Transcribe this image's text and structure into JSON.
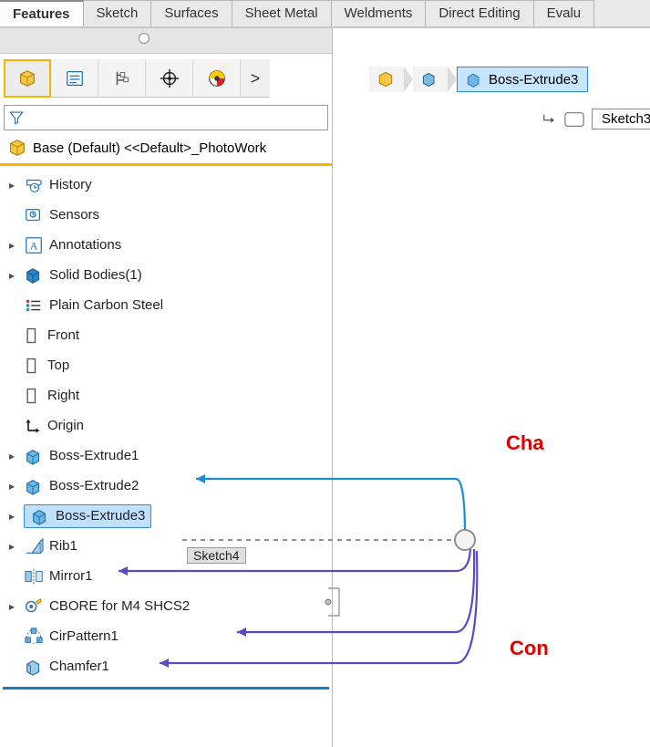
{
  "tabs": {
    "features": "Features",
    "sketch": "Sketch",
    "surfaces": "Surfaces",
    "sheetmetal": "Sheet Metal",
    "weldments": "Weldments",
    "directediting": "Direct Editing",
    "evaluate": "Evalu"
  },
  "fm_toolbar": {
    "overflow": ">"
  },
  "config": {
    "name": "Base (Default) <<Default>_PhotoWork"
  },
  "tree": {
    "history": "History",
    "sensors": "Sensors",
    "annotations": "Annotations",
    "solid_bodies": "Solid Bodies(1)",
    "material": "Plain Carbon Steel",
    "front": "Front",
    "top": "Top",
    "right": "Right",
    "origin": "Origin",
    "boss1": "Boss-Extrude1",
    "boss2": "Boss-Extrude2",
    "boss3": "Boss-Extrude3",
    "rib1": "Rib1",
    "mirror1": "Mirror1",
    "cbore": "CBORE for M4 SHCS2",
    "cirpat": "CirPattern1",
    "chamfer1": "Chamfer1",
    "sketch4_tag": "Sketch4"
  },
  "breadcrumb": {
    "boss3": "Boss-Extrude3",
    "sketch3": "Sketch3"
  },
  "annotations": {
    "cha": "Cha",
    "con": "Con"
  }
}
